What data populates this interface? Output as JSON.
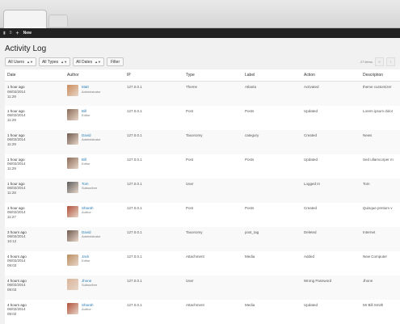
{
  "admin_bar": {
    "comments_count": "0",
    "new_label": "New"
  },
  "page_title": "Activity Log",
  "filters": {
    "users": "All Users",
    "types": "All Types",
    "dates": "All Dates",
    "filter_button": "Filter"
  },
  "items_count": "27 items",
  "pagination": {
    "first": "«",
    "prev": "‹"
  },
  "columns": {
    "date": "Date",
    "author": "Author",
    "ip": "IP",
    "type": "Type",
    "label": "Label",
    "action": "Action",
    "description": "Description"
  },
  "rows": [
    {
      "ago": "1 hour ago",
      "date": "06/02/2014",
      "time": "11:29",
      "author": "Matt",
      "role": "Administrator",
      "ip": "127.0.0.1",
      "type": "Theme",
      "label": "Atlanta",
      "action": "Activated",
      "description": "theme customizer",
      "avatar_color": "#c98a5a"
    },
    {
      "ago": "1 hour ago",
      "date": "06/02/2014",
      "time": "11:29",
      "author": "Bill",
      "role": "Editor",
      "ip": "127.0.0.1",
      "type": "Post",
      "label": "Posts",
      "action": "Updated",
      "description": "Lorem ipsum dolor",
      "avatar_color": "#8a6b58"
    },
    {
      "ago": "1 hour ago",
      "date": "06/02/2014",
      "time": "11:29",
      "author": "David",
      "role": "Administrator",
      "ip": "127.0.0.1",
      "type": "Taxonomy",
      "label": "category",
      "action": "Created",
      "description": "News",
      "avatar_color": "#6e5a50"
    },
    {
      "ago": "1 hour ago",
      "date": "06/02/2014",
      "time": "11:29",
      "author": "Bill",
      "role": "Editor",
      "ip": "127.0.0.1",
      "type": "Post",
      "label": "Posts",
      "action": "Updated",
      "description": "Sed ullamcorper m",
      "avatar_color": "#8a6b58"
    },
    {
      "ago": "1 hour ago",
      "date": "06/02/2014",
      "time": "11:28",
      "author": "Tom",
      "role": "Subscriber",
      "ip": "127.0.0.1",
      "type": "User",
      "label": "",
      "action": "Logged In",
      "description": "Tom",
      "avatar_color": "#5c5c5c"
    },
    {
      "ago": "1 hour ago",
      "date": "06/02/2014",
      "time": "11:27",
      "author": "Sharah",
      "role": "Author",
      "ip": "127.0.0.1",
      "type": "Post",
      "label": "Posts",
      "action": "Created",
      "description": "Quisque pretium v",
      "avatar_color": "#b0503a"
    },
    {
      "ago": "3 hours ago",
      "date": "06/02/2014",
      "time": "10:12",
      "author": "David",
      "role": "Administrator",
      "ip": "127.0.0.1",
      "type": "Taxonomy",
      "label": "post_tag",
      "action": "Deleted",
      "description": "Internet",
      "avatar_color": "#6e5a50"
    },
    {
      "ago": "4 hours ago",
      "date": "06/02/2014",
      "time": "09:03",
      "author": "Jack",
      "role": "Editor",
      "ip": "127.0.0.1",
      "type": "Attachment",
      "label": "Media",
      "action": "Added",
      "description": "New Computer",
      "avatar_color": "#b98d60"
    },
    {
      "ago": "4 hours ago",
      "date": "06/02/2014",
      "time": "09:03",
      "author": "Jhone",
      "role": "Subscriber",
      "ip": "127.0.0.1",
      "type": "User",
      "label": "",
      "action": "Wrong Password",
      "description": "Jhone",
      "avatar_color": "#d9b49a"
    },
    {
      "ago": "4 hours ago",
      "date": "06/02/2014",
      "time": "09:02",
      "author": "Sharah",
      "role": "Author",
      "ip": "127.0.0.1",
      "type": "Attachment",
      "label": "Media",
      "action": "Updated",
      "description": "Mr Bill Smith",
      "avatar_color": "#b0503a"
    }
  ]
}
